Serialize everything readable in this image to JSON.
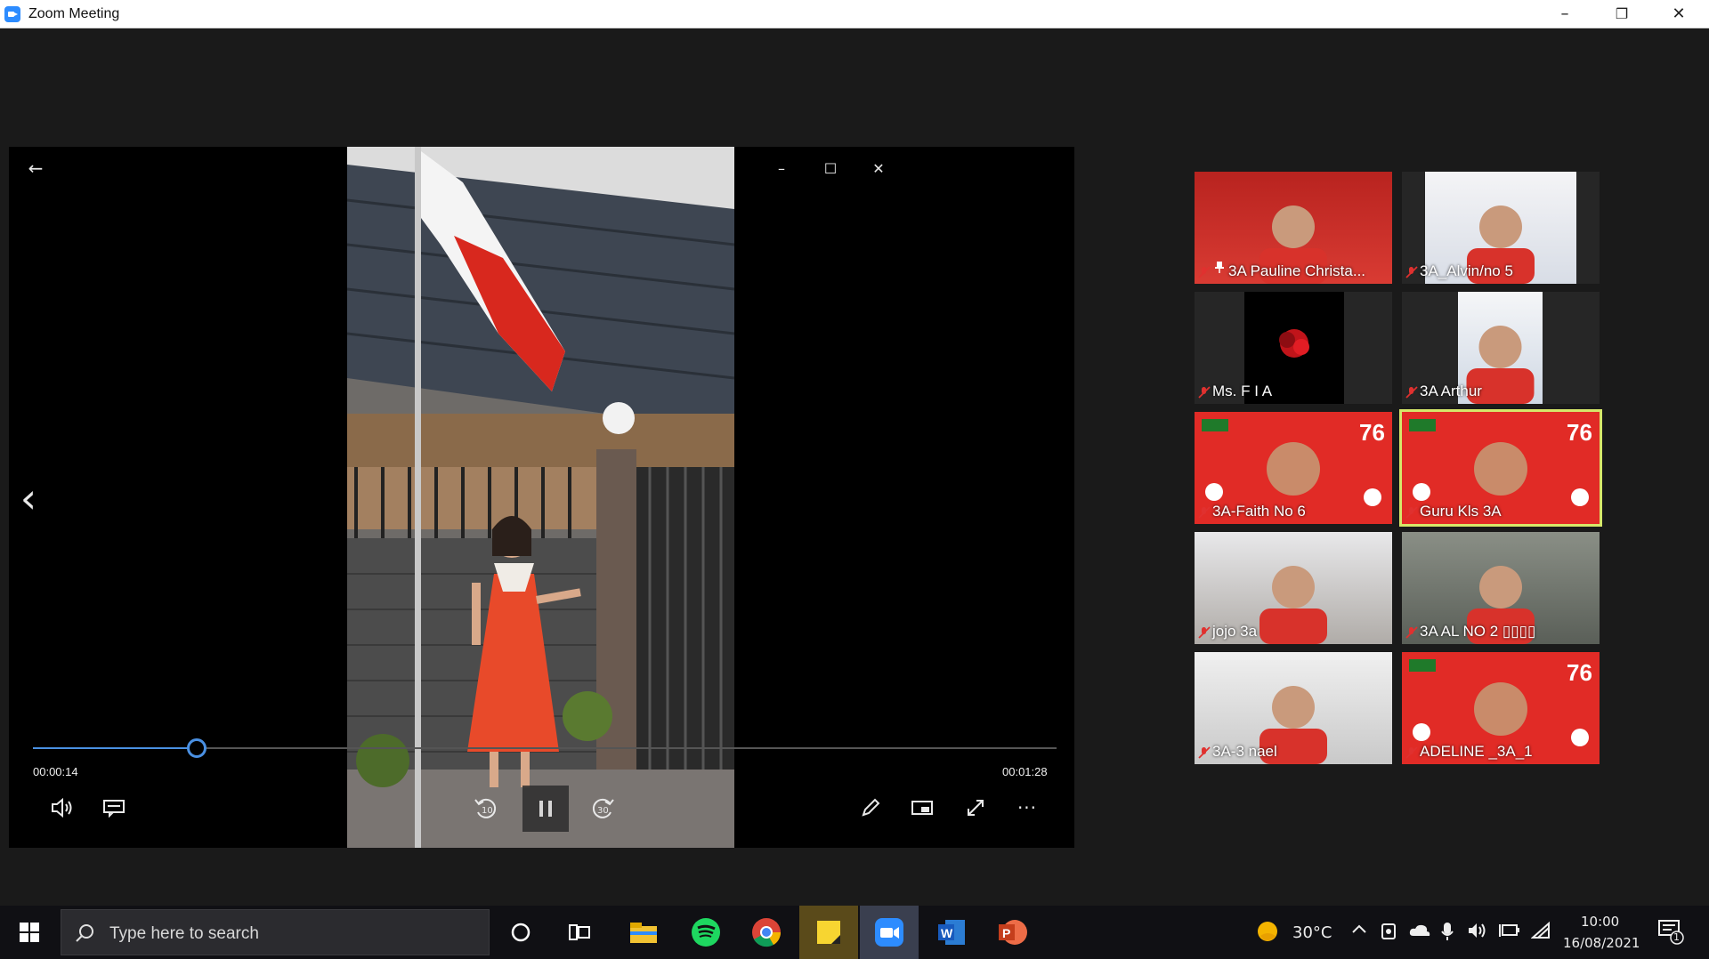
{
  "window": {
    "title": "Zoom Meeting",
    "minimize": "–",
    "restore": "❐",
    "close": "✕"
  },
  "player": {
    "back": "←",
    "minimize": "–",
    "maximize": "☐",
    "close": "✕",
    "prev": "‹",
    "current_time": "00:00:14",
    "total_time": "00:01:28",
    "progress_fraction": 0.16,
    "skip_back_label": "10",
    "skip_forward_label": "30",
    "more": "···"
  },
  "participants": [
    {
      "name": "3A Pauline Christa...",
      "pinned": true
    },
    {
      "name": "3A_Alvin/no 5"
    },
    {
      "name": "Ms. F I A"
    },
    {
      "name": "3A Arthur"
    },
    {
      "name": "3A-Faith No 6"
    },
    {
      "name": "Guru Kls 3A",
      "active_speaker": true
    },
    {
      "name": "jojo 3a"
    },
    {
      "name": "3A AL NO 2 ▯▯▯▯"
    },
    {
      "name": "3A-3 nael"
    },
    {
      "name": "ADELINE _3A_1"
    }
  ],
  "taskbar": {
    "search_placeholder": "Type here to search",
    "weather": "30°C",
    "time": "10:00",
    "date": "16/08/2021",
    "notification_count": "1"
  },
  "colors": {
    "accent": "#4a90e2",
    "active_speaker_border": "#d6e86a",
    "zoom_blue": "#2d8cff",
    "mute_red": "#e0312f"
  }
}
